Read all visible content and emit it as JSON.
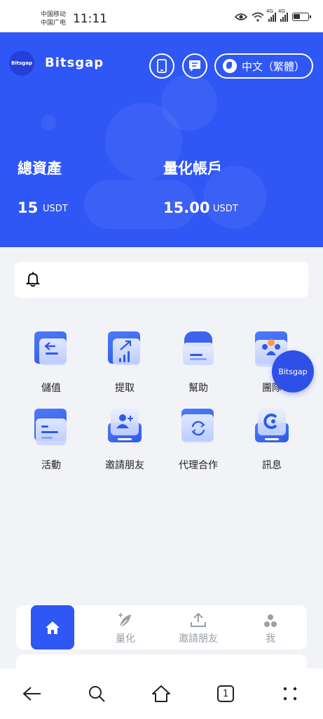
{
  "status_bar": {
    "carrier1": "中国移动",
    "carrier2": "中国广电",
    "time": "11:11",
    "net1": "4G",
    "net2": "4G"
  },
  "header": {
    "logo_text": "Bitsgap",
    "app_name": "Bitsgap",
    "phone_icon": "phone-icon",
    "message_icon": "message-icon",
    "language_label": "中文（繁體）"
  },
  "stats": {
    "total_assets_label": "總資產",
    "total_assets_value": "15",
    "total_assets_unit": "USDT",
    "quant_account_label": "量化帳戶",
    "quant_account_value": "15.00",
    "quant_account_unit": "USDT"
  },
  "notice": {
    "icon": "bell-icon",
    "text": ""
  },
  "grid": [
    {
      "label": "儲值",
      "icon": "deposit-icon"
    },
    {
      "label": "提取",
      "icon": "withdraw-icon"
    },
    {
      "label": "幫助",
      "icon": "help-icon"
    },
    {
      "label": "團隊",
      "icon": "team-icon"
    },
    {
      "label": "活動",
      "icon": "activity-icon"
    },
    {
      "label": "邀請朋友",
      "icon": "invite-icon"
    },
    {
      "label": "代理合作",
      "icon": "agency-icon"
    },
    {
      "label": "訊息",
      "icon": "message-icon"
    }
  ],
  "float_button": {
    "label": "Bitsgap"
  },
  "tabbar": {
    "home": {
      "label": "",
      "icon": "home-icon"
    },
    "quant": {
      "label": "量化",
      "icon": "quant-icon"
    },
    "invite": {
      "label": "邀請朋友",
      "icon": "upload-icon"
    },
    "me": {
      "label": "我",
      "icon": "user-icon"
    }
  },
  "navbar": {
    "tab_count": "1"
  },
  "colors": {
    "primary": "#2f57f5",
    "background": "#f2f3f7",
    "tab_inactive": "#9a9ea8"
  }
}
